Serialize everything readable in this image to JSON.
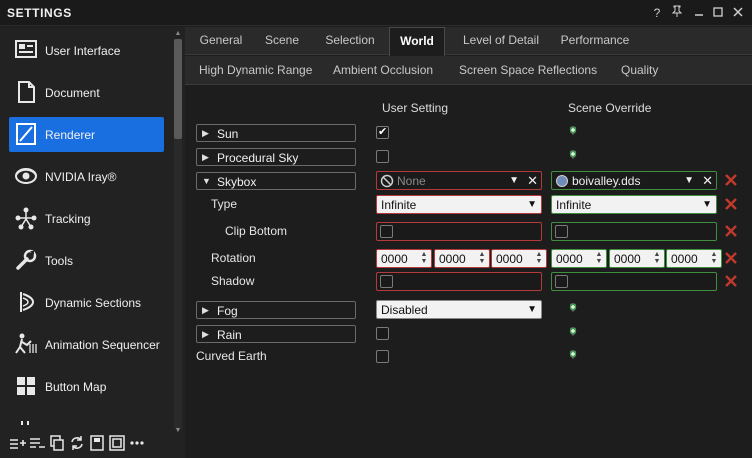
{
  "window": {
    "title": "SETTINGS",
    "controls": [
      "?",
      "pin",
      "minimize",
      "maximize",
      "close"
    ]
  },
  "sidebar": {
    "items": [
      {
        "label": "User Interface",
        "icon": "user-interface-icon",
        "active": false
      },
      {
        "label": "Document",
        "icon": "document-icon",
        "active": false
      },
      {
        "label": "Renderer",
        "icon": "renderer-icon",
        "active": true
      },
      {
        "label": "NVIDIA Iray®",
        "icon": "nvidia-iray-icon",
        "active": false
      },
      {
        "label": "Tracking",
        "icon": "tracking-icon",
        "active": false
      },
      {
        "label": "Tools",
        "icon": "tools-icon",
        "active": false
      },
      {
        "label": "Dynamic Sections",
        "icon": "dynamic-sections-icon",
        "active": false
      },
      {
        "label": "Animation Sequencer",
        "icon": "animation-sequencer-icon",
        "active": false
      },
      {
        "label": "Button Map",
        "icon": "button-map-icon",
        "active": false
      }
    ],
    "bottom_toolbar": [
      "add-icon",
      "add-list-icon",
      "copy-icon",
      "sync-icon",
      "save-icon",
      "frame-icon",
      "more-icon"
    ]
  },
  "tabs": {
    "primary": [
      "General",
      "Scene",
      "Selection",
      "World",
      "Level of Detail",
      "Performance"
    ],
    "active": "World",
    "secondary": [
      "High Dynamic Range",
      "Ambient Occlusion",
      "Screen Space Reflections",
      "Quality"
    ]
  },
  "columns": {
    "user": "User Setting",
    "override": "Scene Override"
  },
  "rows": {
    "sun": {
      "label": "Sun",
      "user_checked": true
    },
    "procedural_sky": {
      "label": "Procedural Sky",
      "user_checked": false
    },
    "skybox": {
      "label": "Skybox",
      "user_value": "None",
      "override_value": "boivalley.dds"
    },
    "type": {
      "label": "Type",
      "user_value": "Infinite",
      "override_value": "Infinite"
    },
    "clip_bottom": {
      "label": "Clip Bottom"
    },
    "rotation": {
      "label": "Rotation",
      "user_values": [
        "0000",
        "0000",
        "0000"
      ],
      "override_values": [
        "0000",
        "0000",
        "0000"
      ]
    },
    "shadow": {
      "label": "Shadow"
    },
    "fog": {
      "label": "Fog",
      "user_value": "Disabled"
    },
    "rain": {
      "label": "Rain",
      "user_checked": false
    },
    "curved_earth": {
      "label": "Curved Earth",
      "user_checked": false
    }
  },
  "colors": {
    "accent": "#1a6fe0",
    "user_border": "#b53a3a",
    "override_border": "#3f8f3f",
    "clear_icon": "#c0392b",
    "add_override_icon": "#3fa34d"
  }
}
